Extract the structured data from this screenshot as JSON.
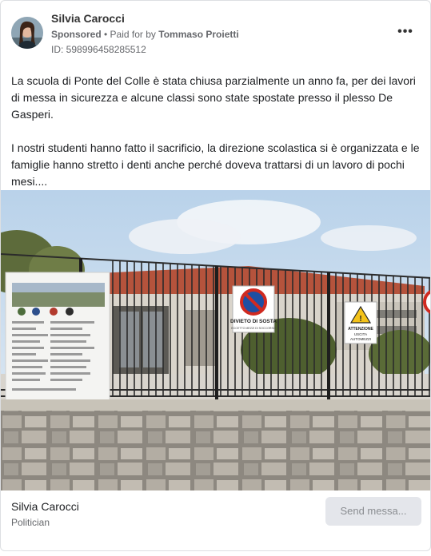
{
  "post": {
    "author": "Silvia Carocci",
    "sponsored_label": "Sponsored",
    "separator": " • ",
    "paid_for_prefix": "Paid for by ",
    "paid_for_by": "Tommaso Proietti",
    "ad_id": "ID: 598996458285512",
    "more_icon": "ellipsis-icon",
    "paragraphs": [
      "La scuola di Ponte del Colle è stata chiusa parzialmente un anno fa, per dei lavori di messa in sicurezza e alcune classi sono state spostate presso il plesso De Gasperi.",
      "I nostri studenti hanno fatto il sacrificio, la direzione scolastica si è organizzata e le famiglie hanno stretto i denti anche perché doveva trattarsi di un lavoro di pochi mesi...."
    ]
  },
  "image": {
    "sign_no_parking_title": "DIVIETO DI SOSTA",
    "sign_no_parking_sub": "ECCETTO MEZZI DI SOCCORSO",
    "sign_warning_title": "ATTENZIONE",
    "sign_warning_sub1": "USCITA",
    "sign_warning_sub2": "AUTOMEZZI"
  },
  "footer": {
    "page_name": "Silvia Carocci",
    "page_category": "Politician",
    "cta_label": "Send messa..."
  },
  "colors": {
    "sky": "#c9dcef",
    "roof": "#b5533c",
    "fence": "#2b2b2b",
    "stone": "#a9a49b",
    "cta_bg": "#e4e6eb"
  }
}
